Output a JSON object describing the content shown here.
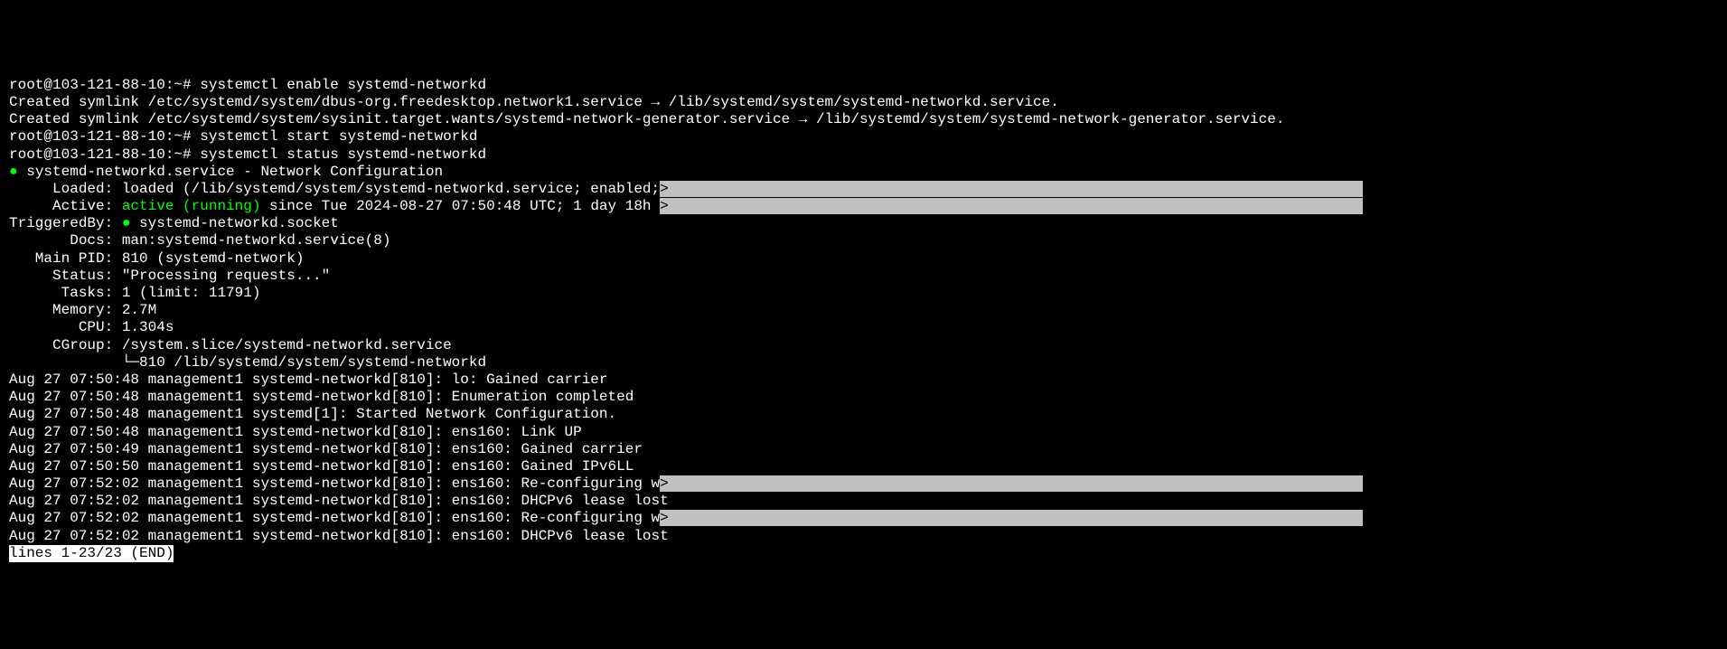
{
  "prompt1": "root@103-121-88-10:~# systemctl enable systemd-networkd",
  "out1": "Created symlink /etc/systemd/system/dbus-org.freedesktop.network1.service → /lib/systemd/system/systemd-networkd.service.",
  "out2": "Created symlink /etc/systemd/system/sysinit.target.wants/systemd-network-generator.service → /lib/systemd/system/systemd-network-generator.service.",
  "prompt2": "root@103-121-88-10:~# systemctl start systemd-networkd",
  "prompt3": "root@103-121-88-10:~# systemctl status systemd-networkd",
  "status_dot": "●",
  "status_title": " systemd-networkd.service - Network Configuration",
  "loaded_label": "     Loaded: loaded (/lib/systemd/system/systemd-networkd.service; enabled;",
  "gt1": ">",
  "hl1_pad": "                                                                                ",
  "active_label": "     Active: ",
  "active_value": "active (running)",
  "active_since": " since Tue 2024-08-27 07:50:48 UTC; 1 day 18h ",
  "gt2": ">",
  "hl2_pad": "                                                                                ",
  "triggeredby_label": "TriggeredBy: ",
  "triggered_dot": "●",
  "triggered_value": " systemd-networkd.socket",
  "docs": "       Docs: man:systemd-networkd.service(8)",
  "mainpid": "   Main PID: 810 (systemd-network)",
  "status_line": "     Status: \"Processing requests...\"",
  "tasks": "      Tasks: 1 (limit: 11791)",
  "memory": "     Memory: 2.7M",
  "cpu": "        CPU: 1.304s",
  "cgroup": "     CGroup: /system.slice/systemd-networkd.service",
  "cgroup_tree": "             └─810 /lib/systemd/system/systemd-networkd",
  "blank": "",
  "log1": "Aug 27 07:50:48 management1 systemd-networkd[810]: lo: Gained carrier",
  "log2": "Aug 27 07:50:48 management1 systemd-networkd[810]: Enumeration completed",
  "log3": "Aug 27 07:50:48 management1 systemd[1]: Started Network Configuration.",
  "log4": "Aug 27 07:50:48 management1 systemd-networkd[810]: ens160: Link UP",
  "log5": "Aug 27 07:50:49 management1 systemd-networkd[810]: ens160: Gained carrier",
  "log6": "Aug 27 07:50:50 management1 systemd-networkd[810]: ens160: Gained IPv6LL",
  "log7_text": "Aug 27 07:52:02 management1 systemd-networkd[810]: ens160: Re-configuring w",
  "gt3": ">",
  "hl3_pad": "                                                                                ",
  "log8": "Aug 27 07:52:02 management1 systemd-networkd[810]: ens160: DHCPv6 lease lost",
  "log9_text": "Aug 27 07:52:02 management1 systemd-networkd[810]: ens160: Re-configuring w",
  "gt4": ">",
  "hl4_pad": "                                                                                ",
  "log10": "Aug 27 07:52:02 management1 systemd-networkd[810]: ens160: DHCPv6 lease lost",
  "pager": "lines 1-23/23 (END)"
}
